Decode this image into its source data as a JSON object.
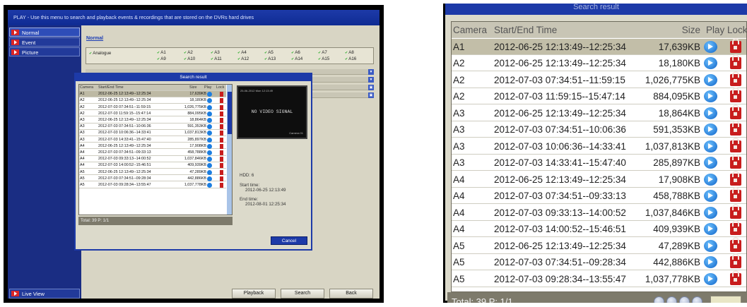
{
  "left": {
    "title": "PLAY - Use this menu to search and playback events & recordings that are stored on the DVRs hard drives",
    "menu": [
      {
        "label": "Normal",
        "selected": true
      },
      {
        "label": "Event",
        "selected": false
      },
      {
        "label": "Picture",
        "selected": false
      }
    ],
    "live_view": "Live View",
    "normal_tab": "Normal",
    "analogue_label": "Analogue",
    "channels": [
      "A1",
      "A2",
      "A3",
      "A4",
      "A5",
      "A6",
      "A7",
      "A8",
      "A9",
      "A10",
      "A11",
      "A12",
      "A13",
      "A14",
      "A15",
      "A16"
    ],
    "buttons": {
      "playback": "Playback",
      "search": "Search",
      "back": "Back"
    },
    "dialog": {
      "title": "Search result",
      "headers": {
        "camera": "Camera",
        "time": "Start/End Time",
        "size": "Size",
        "play": "Play",
        "lock": "Lock"
      },
      "rows": [
        {
          "cam": "A1",
          "time": "2012-06-25 12:13:49--12:25:34",
          "size": "17,639KB"
        },
        {
          "cam": "A2",
          "time": "2012-06-25 12:13:49--12:25:34",
          "size": "18,180KB"
        },
        {
          "cam": "A2",
          "time": "2012-07-03 07:34:51--11:59:15",
          "size": "1,026,775KB"
        },
        {
          "cam": "A2",
          "time": "2012-07-03 11:59:15--15:47:14",
          "size": "884,095KB"
        },
        {
          "cam": "A3",
          "time": "2012-06-25 12:13:49--12:25:34",
          "size": "18,864KB"
        },
        {
          "cam": "A3",
          "time": "2012-07-03 07:34:51--10:06:36",
          "size": "591,353KB"
        },
        {
          "cam": "A3",
          "time": "2012-07-03 10:06:36--14:33:41",
          "size": "1,037,813KB"
        },
        {
          "cam": "A3",
          "time": "2012-07-03 14:33:41--15:47:40",
          "size": "285,897KB"
        },
        {
          "cam": "A4",
          "time": "2012-06-25 12:13:49--12:25:34",
          "size": "17,908KB"
        },
        {
          "cam": "A4",
          "time": "2012-07-03 07:34:51--09:33:13",
          "size": "458,788KB"
        },
        {
          "cam": "A4",
          "time": "2012-07-03 09:33:13--14:00:52",
          "size": "1,037,846KB"
        },
        {
          "cam": "A4",
          "time": "2012-07-03 14:00:52--15:46:51",
          "size": "409,939KB"
        },
        {
          "cam": "A5",
          "time": "2012-06-25 12:13:49--12:25:34",
          "size": "47,289KB"
        },
        {
          "cam": "A5",
          "time": "2012-07-03 07:34:51--09:28:34",
          "size": "442,886KB"
        },
        {
          "cam": "A5",
          "time": "2012-07-03 09:28:34--13:55:47",
          "size": "1,037,778KB"
        }
      ],
      "total": "Total: 39  P: 1/1",
      "preview": {
        "timestamp": "25-06-2012 Mon 12:13:49",
        "no_signal": "NO VIDEO SIGNAL",
        "camera": "Camera 01"
      },
      "hdd": "HDD: 6",
      "start_label": "Start time:",
      "start_value": "2012-06-25 12:13:49",
      "end_label": "End time:",
      "end_value": "2012-08-01 12:25:34",
      "cancel": "Cancel"
    }
  },
  "right": {
    "title": "Search result",
    "headers": {
      "camera": "Camera",
      "time": "Start/End Time",
      "size": "Size",
      "play": "Play",
      "lock": "Lock"
    },
    "rows": [
      {
        "cam": "A1",
        "time": "2012-06-25 12:13:49--12:25:34",
        "size": "17,639KB"
      },
      {
        "cam": "A2",
        "time": "2012-06-25 12:13:49--12:25:34",
        "size": "18,180KB"
      },
      {
        "cam": "A2",
        "time": "2012-07-03 07:34:51--11:59:15",
        "size": "1,026,775KB"
      },
      {
        "cam": "A2",
        "time": "2012-07-03 11:59:15--15:47:14",
        "size": "884,095KB"
      },
      {
        "cam": "A3",
        "time": "2012-06-25 12:13:49--12:25:34",
        "size": "18,864KB"
      },
      {
        "cam": "A3",
        "time": "2012-07-03 07:34:51--10:06:36",
        "size": "591,353KB"
      },
      {
        "cam": "A3",
        "time": "2012-07-03 10:06:36--14:33:41",
        "size": "1,037,813KB"
      },
      {
        "cam": "A3",
        "time": "2012-07-03 14:33:41--15:47:40",
        "size": "285,897KB"
      },
      {
        "cam": "A4",
        "time": "2012-06-25 12:13:49--12:25:34",
        "size": "17,908KB"
      },
      {
        "cam": "A4",
        "time": "2012-07-03 07:34:51--09:33:13",
        "size": "458,788KB"
      },
      {
        "cam": "A4",
        "time": "2012-07-03 09:33:13--14:00:52",
        "size": "1,037,846KB"
      },
      {
        "cam": "A4",
        "time": "2012-07-03 14:00:52--15:46:51",
        "size": "409,939KB"
      },
      {
        "cam": "A5",
        "time": "2012-06-25 12:13:49--12:25:34",
        "size": "47,289KB"
      },
      {
        "cam": "A5",
        "time": "2012-07-03 07:34:51--09:28:34",
        "size": "442,886KB"
      },
      {
        "cam": "A5",
        "time": "2012-07-03 09:28:34--13:55:47",
        "size": "1,037,778KB"
      }
    ],
    "total": "Total: 39  P: 1/1"
  }
}
